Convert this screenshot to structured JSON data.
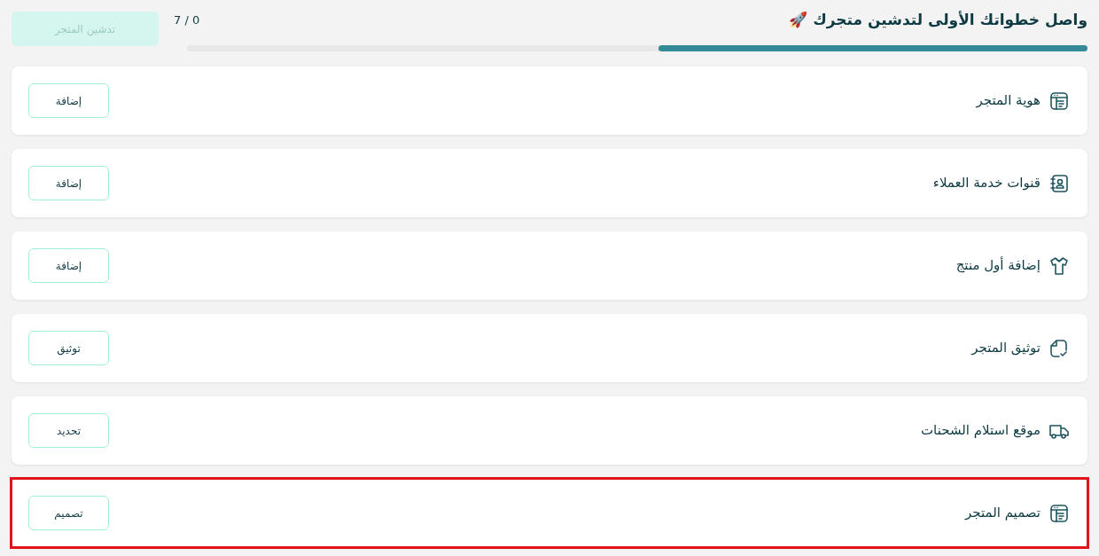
{
  "header": {
    "title": "واصل خطواتك الأولى لتدشين متجرك 🚀",
    "progress_text": "0 / 7",
    "level": 0.476,
    "launch_button": {
      "label": "تدشين المتجر",
      "disabled": true
    }
  },
  "steps": [
    {
      "title": "هوية المتجر",
      "button": "إضافة",
      "highlighted": false
    },
    {
      "title": "قنوات خدمة العملاء",
      "button": "إضافة",
      "highlighted": false
    },
    {
      "title": "إضافة أول منتج",
      "button": "إضافة",
      "highlighted": false
    },
    {
      "title": "توثيق المتجر",
      "button": "توثيق",
      "highlighted": false
    },
    {
      "title": "موقع استلام الشحنات",
      "button": "تحديد",
      "highlighted": false
    },
    {
      "title": "تصميم المتجر",
      "button": "تصميم",
      "highlighted": true
    }
  ]
}
